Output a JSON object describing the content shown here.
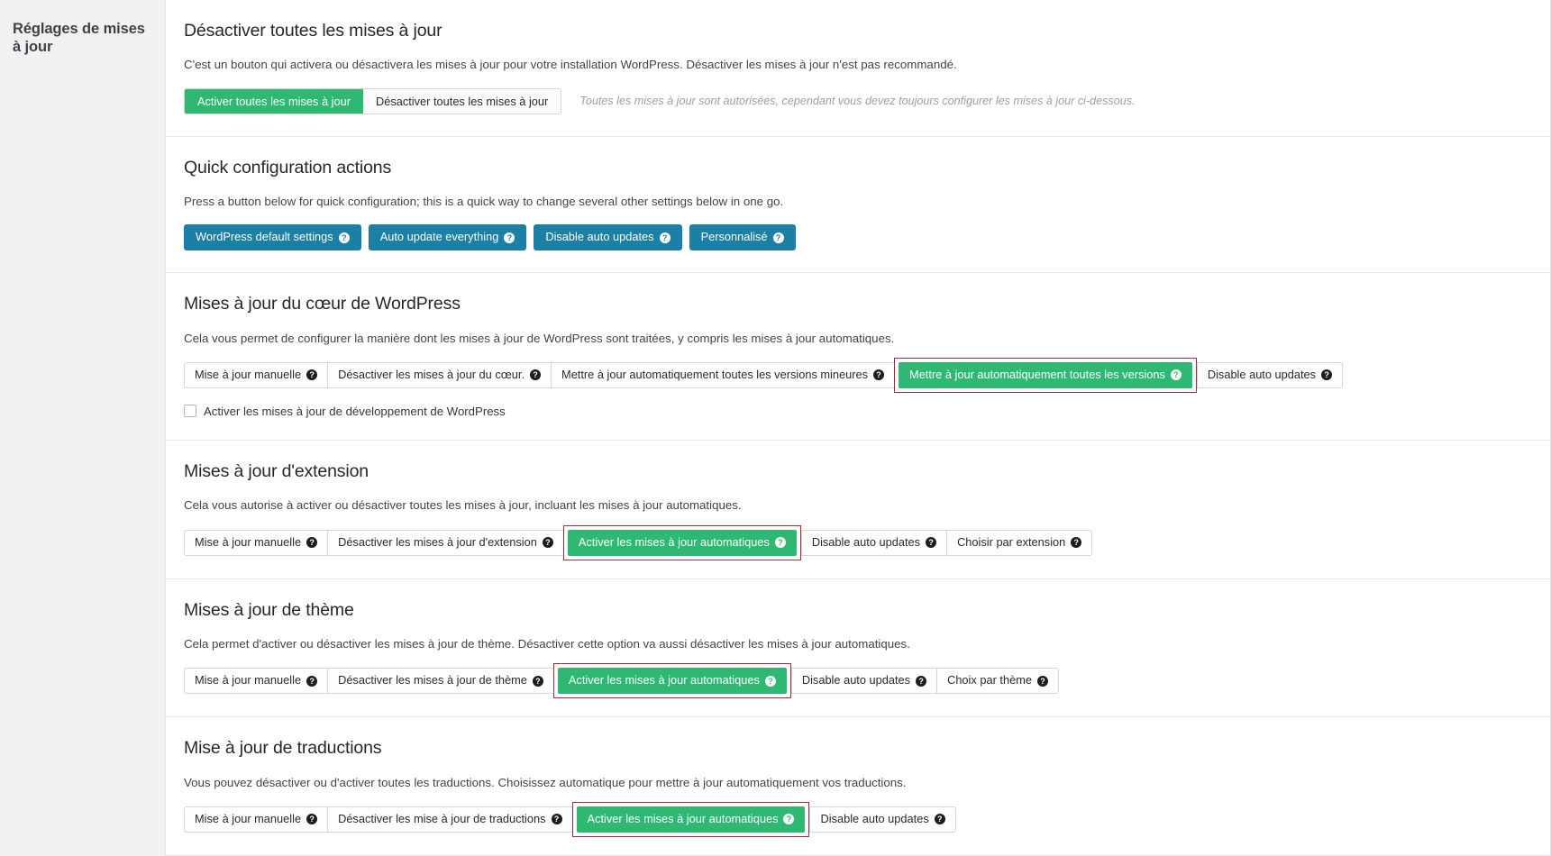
{
  "sidebar": {
    "title": "Réglages de mises à jour"
  },
  "help_icon_glyph": "?",
  "colors": {
    "green": "#2eb872",
    "blue": "#1b7fa6",
    "highlight_outline": "#9e2b3a",
    "page_background": "#f1f1f1",
    "card_background": "#ffffff"
  },
  "sections": {
    "disable_all": {
      "title": "Désactiver toutes les mises à jour",
      "desc": "C'est un bouton qui activera ou désactivera les mises à jour pour votre installation WordPress. Désactiver les mises à jour n'est pas recommandé.",
      "toggle": {
        "enable_label": "Activer toutes les mises à jour",
        "disable_label": "Désactiver toutes les mises à jour",
        "active": "enable"
      },
      "note": "Toutes les mises à jour sont autorisées, cependant vous devez toujours configurer les mises à jour ci-dessous."
    },
    "quick_actions": {
      "title": "Quick configuration actions",
      "desc": "Press a button below for quick configuration; this is a quick way to change several other settings below in one go.",
      "buttons": [
        {
          "label": "WordPress default settings",
          "help": true
        },
        {
          "label": "Auto update everything",
          "help": true
        },
        {
          "label": "Disable auto updates",
          "help": true
        },
        {
          "label": "Personnalisé",
          "help": true
        }
      ]
    },
    "core": {
      "title": "Mises à jour du cœur de WordPress",
      "desc": "Cela vous permet de configurer la manière dont les mises à jour de WordPress sont traitées, y compris les mises à jour automatiques.",
      "buttons": [
        {
          "label": "Mise à jour manuelle",
          "help": true,
          "state": "default",
          "highlighted": false
        },
        {
          "label": "Désactiver les mises à jour du cœur.",
          "help": true,
          "state": "default",
          "highlighted": false
        },
        {
          "label": "Mettre à jour automatiquement toutes les versions mineures",
          "help": true,
          "state": "default",
          "highlighted": false
        },
        {
          "label": "Mettre à jour automatiquement toutes les versions",
          "help": true,
          "state": "selected",
          "highlighted": true
        },
        {
          "label": "Disable auto updates",
          "help": true,
          "state": "default",
          "highlighted": false
        }
      ],
      "checkbox": {
        "label": "Activer les mises à jour de développement de WordPress",
        "checked": false
      }
    },
    "plugins": {
      "title": "Mises à jour d'extension",
      "desc": "Cela vous autorise à activer ou désactiver toutes les mises à jour, incluant les mises à jour automatiques.",
      "buttons": [
        {
          "label": "Mise à jour manuelle",
          "help": true,
          "state": "default",
          "highlighted": false
        },
        {
          "label": "Désactiver les mises à jour d'extension",
          "help": true,
          "state": "default",
          "highlighted": false
        },
        {
          "label": "Activer les mises à jour automatiques",
          "help": true,
          "state": "selected",
          "highlighted": true
        },
        {
          "label": "Disable auto updates",
          "help": true,
          "state": "default",
          "highlighted": false
        },
        {
          "label": "Choisir par extension",
          "help": true,
          "state": "default",
          "highlighted": false
        }
      ]
    },
    "themes": {
      "title": "Mises à jour de thème",
      "desc": "Cela permet d'activer ou désactiver les mises à jour de thème. Désactiver cette option va aussi désactiver les mises à jour automatiques.",
      "buttons": [
        {
          "label": "Mise à jour manuelle",
          "help": true,
          "state": "default",
          "highlighted": false
        },
        {
          "label": "Désactiver les mises à jour de thème",
          "help": true,
          "state": "default",
          "highlighted": false
        },
        {
          "label": "Activer les mises à jour automatiques",
          "help": true,
          "state": "selected",
          "highlighted": true
        },
        {
          "label": "Disable auto updates",
          "help": true,
          "state": "default",
          "highlighted": false
        },
        {
          "label": "Choix par thème",
          "help": true,
          "state": "default",
          "highlighted": false
        }
      ]
    },
    "translations": {
      "title": "Mise à jour de traductions",
      "desc": "Vous pouvez désactiver ou d'activer toutes les traductions. Choisissez automatique pour mettre à jour automatiquement vos traductions.",
      "buttons": [
        {
          "label": "Mise à jour manuelle",
          "help": true,
          "state": "default",
          "highlighted": false
        },
        {
          "label": "Désactiver les mise à jour de traductions",
          "help": true,
          "state": "default",
          "highlighted": false
        },
        {
          "label": "Activer les mises à jour automatiques",
          "help": true,
          "state": "selected",
          "highlighted": true
        },
        {
          "label": "Disable auto updates",
          "help": true,
          "state": "default",
          "highlighted": false
        }
      ]
    }
  }
}
